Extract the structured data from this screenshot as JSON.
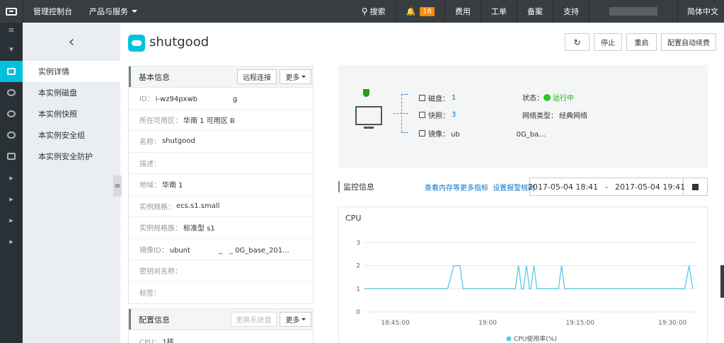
{
  "topbar": {
    "console": "管理控制台",
    "products": "产品与服务",
    "search": "搜索",
    "bell_count": "16",
    "billing": "费用",
    "tickets": "工单",
    "filing": "备案",
    "support": "支持",
    "language": "简体中文"
  },
  "subnav": {
    "items": [
      {
        "label": "实例详情",
        "active": true
      },
      {
        "label": "本实例磁盘"
      },
      {
        "label": "本实例快照"
      },
      {
        "label": "本实例安全组"
      },
      {
        "label": "本实例安全防护"
      }
    ]
  },
  "header": {
    "title": "shutgood",
    "refresh_icon": "refresh-icon",
    "stop": "停止",
    "restart": "重启",
    "auto_renew": "配置自动续费"
  },
  "basic": {
    "title": "基本信息",
    "remote": "远程连接",
    "more": "更多",
    "rows": [
      {
        "label": "ID：",
        "value": "i-wz94pxwb　　　　　g"
      },
      {
        "label": "所在可用区：",
        "value": "华南 1 可用区 B"
      },
      {
        "label": "名称：",
        "value": "shutgood"
      },
      {
        "label": "描述：",
        "value": ""
      },
      {
        "label": "地域：",
        "value": "华南 1"
      },
      {
        "label": "实例规格：",
        "value": "ecs.s1.small"
      },
      {
        "label": "实例规格族：",
        "value": "标准型 s1"
      },
      {
        "label": "镜像ID：",
        "value": "ubunt　　　　_　_ 0G_base_201..."
      },
      {
        "label": "密钥对名称：",
        "value": ""
      },
      {
        "label": "标签：",
        "value": ""
      }
    ]
  },
  "config": {
    "title": "配置信息",
    "change_os": "更换系统盘",
    "more": "更多",
    "cpu_label": "CPU：",
    "cpu_value": "1核"
  },
  "overview": {
    "disk_label": "磁盘：",
    "disk_value": "1",
    "snapshot_label": "快照：",
    "snapshot_value": "3",
    "image_label": "镜像：",
    "image_value": "ub　　　　　　　　0G_ba...",
    "status_label": "状态：",
    "status_value": "运行中",
    "network_label": "网络类型：",
    "network_value": "经典网络"
  },
  "monitor": {
    "title": "监控信息",
    "more_link": "查看内存等更多指标",
    "alarm_link": "设置报警规则",
    "date_from": "2017-05-04 18:41",
    "date_sep": "-",
    "date_to": "2017-05-04 19:41"
  },
  "chart_data": {
    "type": "line",
    "title": "CPU",
    "x": [
      "18:45:00",
      "19:00",
      "19:15:00",
      "19:30:00"
    ],
    "ylim": [
      0,
      3
    ],
    "yticks": [
      0,
      1,
      2,
      3
    ],
    "series": [
      {
        "name": "CPU使用率(%)",
        "color": "#5bc8e8",
        "points": [
          [
            0,
            1
          ],
          [
            13.5,
            1
          ],
          [
            14.5,
            2
          ],
          [
            15.5,
            2
          ],
          [
            16,
            1
          ],
          [
            24.5,
            1
          ],
          [
            25,
            2
          ],
          [
            25.5,
            1
          ],
          [
            25.8,
            1
          ],
          [
            26.3,
            2
          ],
          [
            26.8,
            1
          ],
          [
            27,
            1
          ],
          [
            27.5,
            2
          ],
          [
            28,
            1
          ],
          [
            31.5,
            1
          ],
          [
            32,
            2
          ],
          [
            32.5,
            1
          ],
          [
            52,
            1
          ],
          [
            52.7,
            2
          ],
          [
            53.3,
            1
          ]
        ]
      }
    ],
    "legend": "bottom"
  }
}
